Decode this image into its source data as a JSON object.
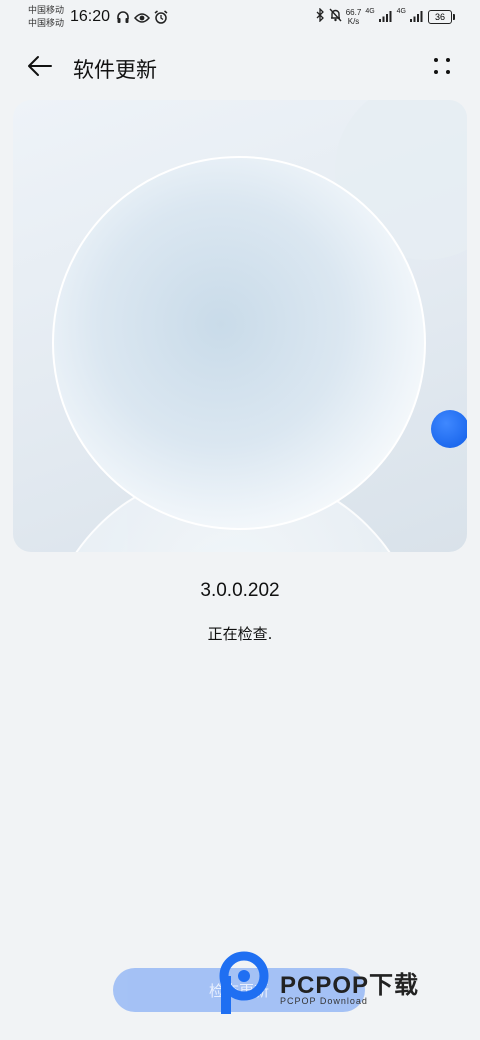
{
  "status_bar": {
    "carrier_1": "中国移动",
    "carrier_2": "中国移动",
    "time": "16:20",
    "speed_value": "66.7",
    "speed_unit": "K/s",
    "net_1": "4G",
    "net_2": "4G",
    "battery": "36"
  },
  "header": {
    "title": "软件更新",
    "back_icon": "arrow-left-icon",
    "more_icon": "more-dots-icon"
  },
  "content": {
    "version": "3.0.0.202",
    "status": "正在检查."
  },
  "bottom": {
    "button_label": "检查更新"
  },
  "watermark": {
    "brand": "PCPOP下载",
    "sub": "PCPOP Download"
  },
  "colors": {
    "background": "#f1f3f5",
    "accent_dot": "#1f6ff2",
    "button": "#9cbcf5"
  }
}
